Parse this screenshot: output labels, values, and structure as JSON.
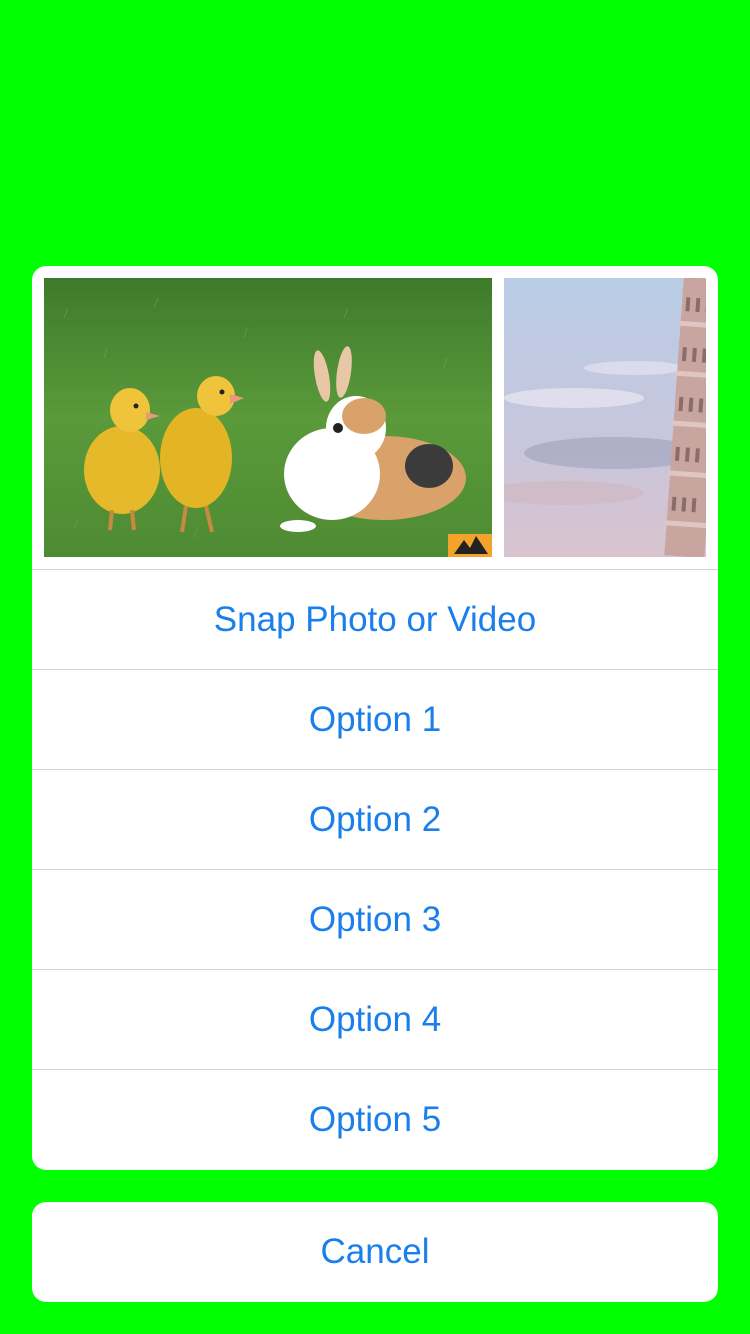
{
  "colors": {
    "backdrop": "#00FF00",
    "accent": "#1A7FEC",
    "sheet_background": "#FFFFFF",
    "separator": "#D1D1D6"
  },
  "photo_strip": {
    "photos": [
      {
        "subject": "ducklings-and-rabbit-on-grass"
      },
      {
        "subject": "leaning-tower-against-cloudy-sky"
      }
    ]
  },
  "action_sheet": {
    "items": [
      {
        "label": "Snap Photo or Video"
      },
      {
        "label": "Option 1"
      },
      {
        "label": "Option 2"
      },
      {
        "label": "Option 3"
      },
      {
        "label": "Option 4"
      },
      {
        "label": "Option 5"
      }
    ],
    "cancel_label": "Cancel"
  }
}
